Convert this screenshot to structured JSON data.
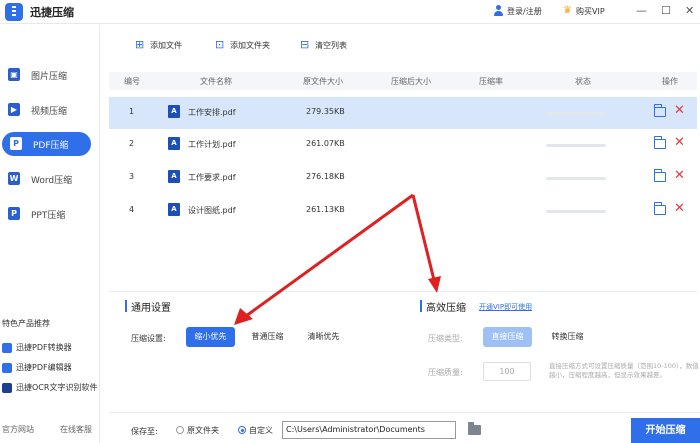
{
  "app": {
    "title": "迅捷压缩"
  },
  "header": {
    "login_label": "登录/注册",
    "buy_vip_label": "购买VIP",
    "window_buttons": [
      "—",
      "☐",
      "✕"
    ]
  },
  "sidebar": {
    "items": [
      {
        "label": "图片压缩",
        "icon": "image-icon",
        "active": false
      },
      {
        "label": "视频压缩",
        "icon": "video-icon",
        "active": false
      },
      {
        "label": "PDF压缩",
        "icon": "pdf-icon",
        "active": true
      },
      {
        "label": "Word压缩",
        "icon": "word-icon",
        "active": false
      },
      {
        "label": "PPT压缩",
        "icon": "ppt-icon",
        "active": false
      }
    ],
    "featured_title": "特色产品推荐",
    "featured": [
      {
        "label": "迅捷PDF转换器",
        "icon": "pdf-converter-icon"
      },
      {
        "label": "迅捷PDF编辑器",
        "icon": "pdf-editor-icon"
      },
      {
        "label": "迅捷OCR文字识别软件",
        "icon": "ocr-icon"
      }
    ],
    "footer": {
      "website": "官方网站",
      "support": "在线客服"
    }
  },
  "toolbar": {
    "add_file": "添加文件",
    "add_folder": "添加文件夹",
    "clear_list": "清空列表"
  },
  "table": {
    "headers": [
      "编号",
      "文件名称",
      "原文件大小",
      "压缩后大小",
      "压缩率",
      "状态",
      "操作"
    ],
    "rows": [
      {
        "num": "1",
        "name": "工作安排.pdf",
        "size": "279.35KB",
        "compressed": "",
        "ratio": "",
        "selected": true
      },
      {
        "num": "2",
        "name": "工作计划.pdf",
        "size": "261.07KB",
        "compressed": "",
        "ratio": "",
        "selected": false
      },
      {
        "num": "3",
        "name": "工作要求.pdf",
        "size": "276.18KB",
        "compressed": "",
        "ratio": "",
        "selected": false
      },
      {
        "num": "4",
        "name": "设计图纸.pdf",
        "size": "261.13KB",
        "compressed": "",
        "ratio": "",
        "selected": false
      }
    ]
  },
  "general": {
    "title": "通用设置",
    "label": "压缩设置:",
    "options": [
      "缩小优先",
      "普通压缩",
      "清晰优先"
    ],
    "selected": "缩小优先"
  },
  "advanced": {
    "title": "高效压缩",
    "vip_link": "开通VIP即可使用",
    "type_label": "压缩类型:",
    "type_options": [
      "直接压缩",
      "转换压缩"
    ],
    "quality_label": "压缩质量:",
    "quality_value": "100",
    "hint": "直接压缩方式可设置压缩质量（范围10-100），数值越小，压缩程度越高，但显示效果越差。"
  },
  "bottom": {
    "save_label": "保存至:",
    "radio_original": "原文件夹",
    "radio_custom": "自定义",
    "path_value": "C:\\Users\\Administrator\\Documents",
    "start_button": "开始压缩"
  },
  "colors": {
    "accent": "#2f6fe9",
    "selected_row": "#d8e6fb",
    "delete": "#e23b3b",
    "annotation_arrow": "#e02020"
  }
}
